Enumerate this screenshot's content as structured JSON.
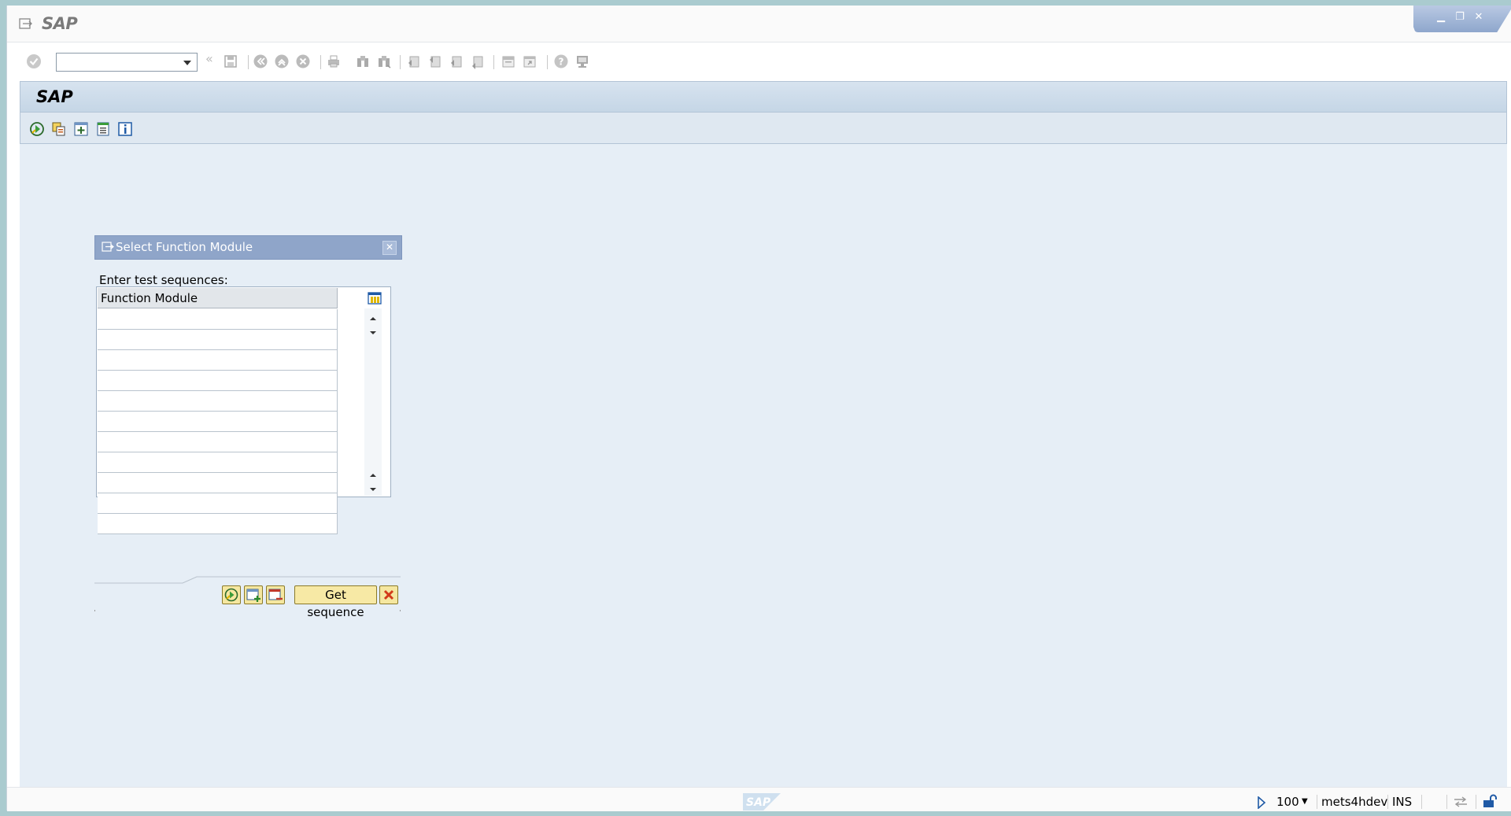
{
  "window": {
    "title": "SAP",
    "controls": [
      "minimize-icon",
      "restore-icon",
      "close-icon"
    ]
  },
  "system_toolbar": {
    "command_field": {
      "value": "",
      "placeholder": ""
    },
    "icons": [
      "enter-icon",
      "back-icon",
      "save-icon",
      "back-nav-icon",
      "exit-icon",
      "cancel-icon",
      "print-icon",
      "find-icon",
      "find-next-icon",
      "first-page-icon",
      "previous-page-icon",
      "next-page-icon",
      "last-page-icon",
      "new-session-icon",
      "shortcut-icon",
      "help-icon",
      "customize-layout-icon"
    ]
  },
  "app": {
    "title": "SAP",
    "toolbar_icons": [
      "execute-icon",
      "copy-icon",
      "create-icon",
      "change-icon",
      "info-icon"
    ]
  },
  "dialog": {
    "title": "Select Function Module",
    "prompt": "Enter test sequences:",
    "table": {
      "column_header": "Function Module",
      "rows": [
        "",
        "",
        "",
        "",
        "",
        "",
        "",
        "",
        "",
        "",
        ""
      ]
    },
    "buttons": {
      "get_sequence": "Get sequence"
    }
  },
  "statusbar": {
    "client": "100",
    "server": "mets4hdev",
    "mode": "INS"
  },
  "colors": {
    "workarea": "#e6eef6",
    "dialog_title": "#8fa5c9",
    "button": "#f7e9a5"
  }
}
